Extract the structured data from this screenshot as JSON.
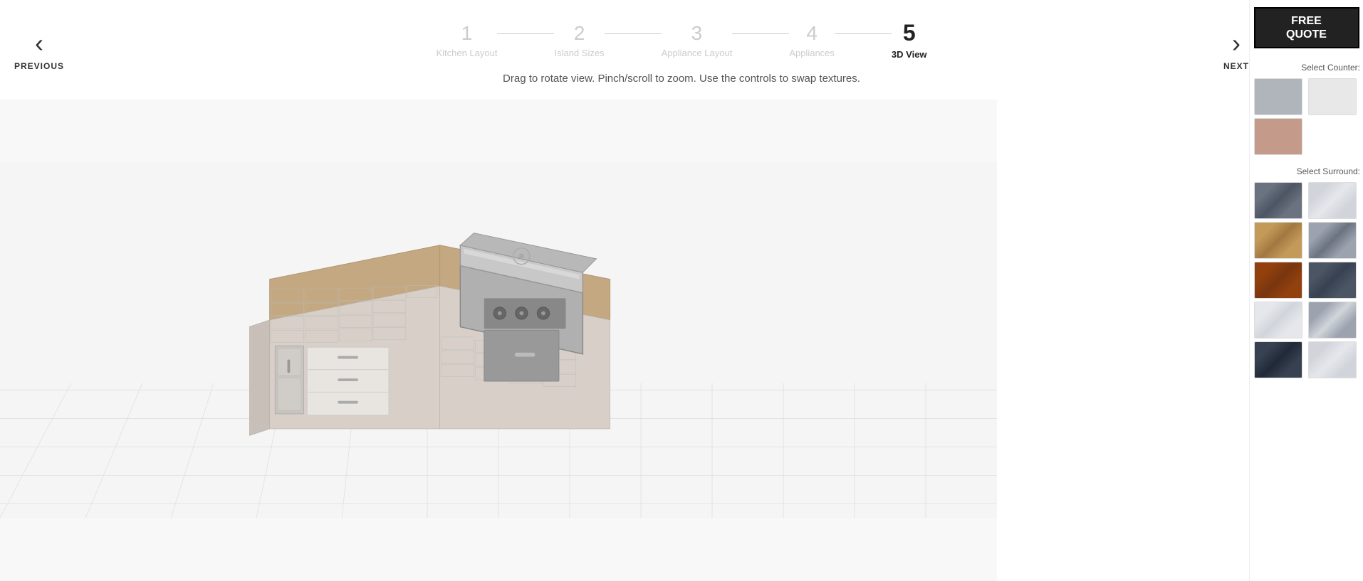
{
  "stepper": {
    "steps": [
      {
        "number": "1",
        "label": "Kitchen Layout",
        "active": false
      },
      {
        "number": "2",
        "label": "Island Sizes",
        "active": false
      },
      {
        "number": "3",
        "label": "Appliance Layout",
        "active": false
      },
      {
        "number": "4",
        "label": "Appliances",
        "active": false
      },
      {
        "number": "5",
        "label": "3D View",
        "active": true
      }
    ]
  },
  "subtitle": "Drag to rotate view. Pinch/scroll to zoom. Use the controls to swap textures.",
  "nav": {
    "prev_label": "PREVIOUS",
    "next_label": "NEXT"
  },
  "panel": {
    "cta_label": "FREE\nQUOTE",
    "counter_label": "Select Counter:",
    "surround_label": "Select Surround:",
    "counter_swatches": [
      {
        "id": "c1",
        "class": "swatch-gray"
      },
      {
        "id": "c2",
        "class": "swatch-light"
      },
      {
        "id": "c3",
        "class": "swatch-rose"
      }
    ],
    "surround_swatches": [
      {
        "id": "s1",
        "class": "swatch-stone-dark"
      },
      {
        "id": "s2",
        "class": "swatch-stone-light"
      },
      {
        "id": "s3",
        "class": "swatch-brick-tan"
      },
      {
        "id": "s4",
        "class": "swatch-stone-gray2"
      },
      {
        "id": "s5",
        "class": "swatch-wood-brown"
      },
      {
        "id": "s6",
        "class": "swatch-slate"
      },
      {
        "id": "s7",
        "class": "swatch-concrete-light"
      },
      {
        "id": "s8",
        "class": "swatch-concrete-mid"
      },
      {
        "id": "s9",
        "class": "swatch-dark-slate"
      },
      {
        "id": "s10",
        "class": "swatch-light-gray2"
      }
    ]
  }
}
